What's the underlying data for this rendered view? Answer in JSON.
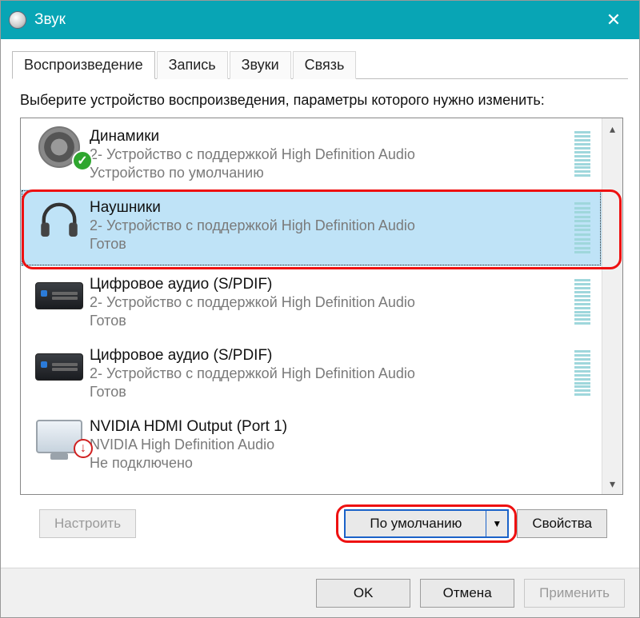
{
  "title": "Звук",
  "close_glyph": "✕",
  "tabs": [
    {
      "label": "Воспроизведение",
      "active": true
    },
    {
      "label": "Запись",
      "active": false
    },
    {
      "label": "Звуки",
      "active": false
    },
    {
      "label": "Связь",
      "active": false
    }
  ],
  "instruction": "Выберите устройство воспроизведения, параметры которого нужно изменить:",
  "devices": [
    {
      "name": "Динамики",
      "sub1": "2- Устройство с поддержкой High Definition Audio",
      "sub2": "Устройство по умолчанию",
      "icon": "speaker",
      "badge": "check",
      "selected": false,
      "disconnected": false
    },
    {
      "name": "Наушники",
      "sub1": "2- Устройство с поддержкой High Definition Audio",
      "sub2": "Готов",
      "icon": "headphones",
      "badge": "",
      "selected": true,
      "disconnected": false
    },
    {
      "name": "Цифровое аудио (S/PDIF)",
      "sub1": "2- Устройство с поддержкой High Definition Audio",
      "sub2": "Готов",
      "icon": "receiver",
      "badge": "",
      "selected": false,
      "disconnected": false
    },
    {
      "name": "Цифровое аудио (S/PDIF)",
      "sub1": "2- Устройство с поддержкой High Definition Audio",
      "sub2": "Готов",
      "icon": "receiver",
      "badge": "",
      "selected": false,
      "disconnected": false
    },
    {
      "name": "NVIDIA HDMI Output (Port 1)",
      "sub1": "NVIDIA High Definition Audio",
      "sub2": "Не подключено",
      "icon": "monitor",
      "badge": "down",
      "selected": false,
      "disconnected": true
    }
  ],
  "buttons": {
    "configure": "Настроить",
    "set_default": "По умолчанию",
    "properties": "Свойства",
    "ok": "OK",
    "cancel": "Отмена",
    "apply": "Применить"
  },
  "scroll": {
    "up_glyph": "▴",
    "down_glyph": "▾"
  },
  "drop_glyph": "▼",
  "colors": {
    "accent": "#08a5b5",
    "highlight": "#e11",
    "selection": "#bfe3f7"
  }
}
